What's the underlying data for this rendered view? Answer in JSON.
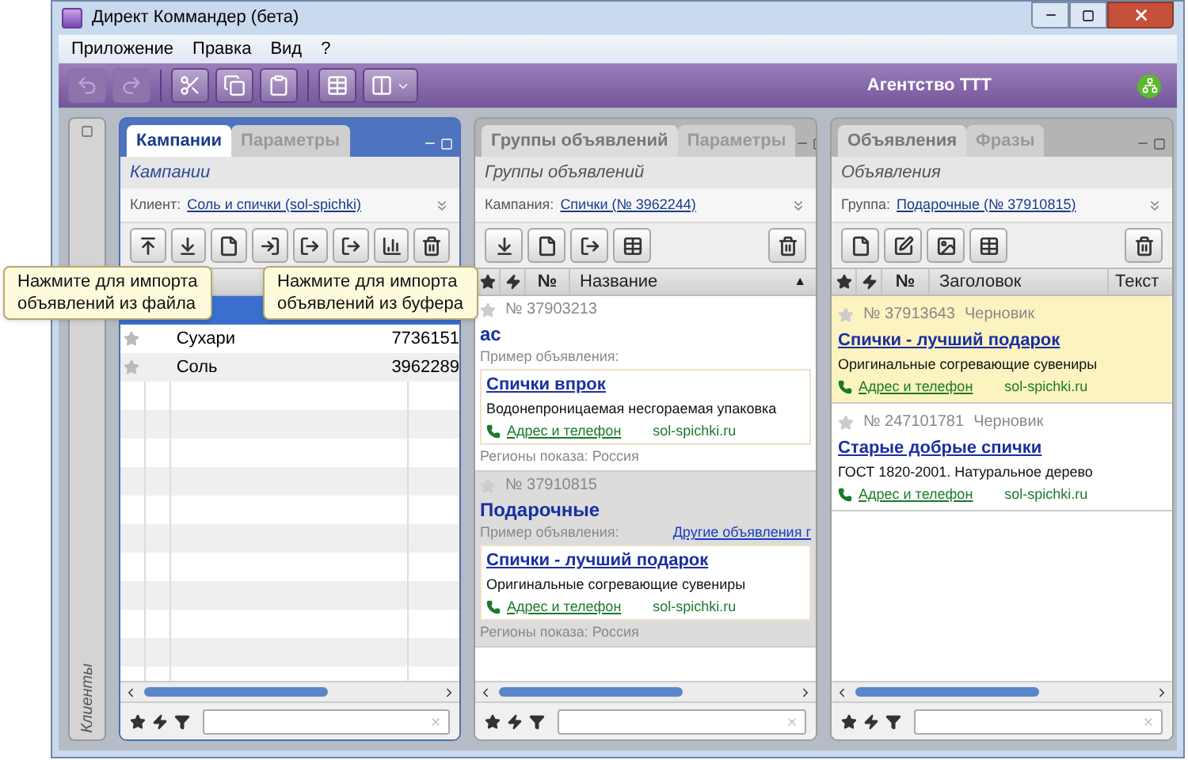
{
  "window": {
    "title": "Директ Коммандер (бета)"
  },
  "menu": [
    "Приложение",
    "Правка",
    "Вид",
    "?"
  ],
  "toolbar": [
    {
      "kind": "undo",
      "disabled": true
    },
    {
      "kind": "redo",
      "disabled": true
    },
    {
      "kind": "cut",
      "disabled": false
    },
    {
      "kind": "copy",
      "disabled": false
    },
    {
      "kind": "paste",
      "disabled": false
    },
    {
      "kind": "table",
      "disabled": false
    },
    {
      "kind": "split",
      "disabled": false
    }
  ],
  "agency": "Агентство ТТТ",
  "side_panel": {
    "label": "Клиенты"
  },
  "campaigns_panel": {
    "active": true,
    "tabs": [
      {
        "label": "Кампании",
        "selected": true
      },
      {
        "label": "Параметры",
        "selected": false
      }
    ],
    "subtitle": "Кампании",
    "filter": {
      "label": "Клиент:",
      "value": "Соль и спички (sol-spichki)"
    },
    "tools": [
      {
        "kind": "upload"
      },
      {
        "kind": "download"
      },
      {
        "kind": "new"
      },
      {
        "kind": "import_file"
      },
      {
        "kind": "import_buffer"
      },
      {
        "kind": "export"
      },
      {
        "kind": "stats"
      }
    ],
    "rows": [
      {
        "selected": true
      },
      {
        "selected": false,
        "name": "Сухари",
        "number": "7736151"
      },
      {
        "selected": false,
        "name": "Соль",
        "number": "3962289"
      }
    ]
  },
  "groups_panel": {
    "active": false,
    "tabs": [
      {
        "label": "Группы объявлений",
        "selected": true
      },
      {
        "label": "Параметры",
        "selected": false
      }
    ],
    "subtitle": "Группы объявлений",
    "filter": {
      "label": "Кампания:",
      "value": "Спички (№ 3962244)"
    },
    "tools": [
      {
        "kind": "download"
      },
      {
        "kind": "new"
      },
      {
        "kind": "export"
      },
      {
        "kind": "table"
      }
    ],
    "columns": [
      "№",
      "Название"
    ],
    "sort_mark": "▲",
    "groups": [
      {
        "selected": false,
        "number": "№ 37903213",
        "name": "ас",
        "sample_label": "Пример объявления:",
        "ad": {
          "title": "Спички впрок",
          "text": "Водонепроницаемая несгораемая упаковка",
          "link": "Адрес и телефон",
          "domain": "sol-spichki.ru"
        },
        "regions": "Регионы показа: Россия"
      },
      {
        "selected": true,
        "number": "№ 37910815",
        "name": "Подарочные",
        "sample_label": "Пример объявления:",
        "other_link": "Другие объявления г",
        "ad": {
          "title": "Спички - лучший подарок",
          "text": "Оригинальные согревающие сувениры",
          "link": "Адрес и телефон",
          "domain": "sol-spichki.ru"
        },
        "regions": "Регионы показа: Россия"
      }
    ]
  },
  "ads_panel": {
    "active": false,
    "tabs": [
      {
        "label": "Объявления",
        "selected": true
      },
      {
        "label": "Фразы",
        "selected": false
      }
    ],
    "subtitle": "Объявления",
    "filter": {
      "label": "Группа:",
      "value": "Подарочные (№ 37910815)"
    },
    "tools": [
      {
        "kind": "new"
      },
      {
        "kind": "edit"
      },
      {
        "kind": "image"
      },
      {
        "kind": "table"
      }
    ],
    "columns": [
      "№",
      "Заголовок",
      "Текст"
    ],
    "ads": [
      {
        "selected": true,
        "number": "№ 37913643",
        "status": "Черновик",
        "title": "Спички - лучший подарок",
        "text": "Оригинальные согревающие сувениры",
        "link": "Адрес и телефон",
        "domain": "sol-spichki.ru"
      },
      {
        "selected": false,
        "number": "№ 247101781",
        "status": "Черновик",
        "title": "Старые добрые спички",
        "text": "ГОСТ 1820-2001. Натуральное дерево",
        "link": "Адрес и телефон",
        "domain": "sol-spichki.ru"
      }
    ]
  },
  "tooltips": [
    "Нажмите для импорта\nобъявлений из файла",
    "Нажмите для импорта\nобъявлений из буфера"
  ]
}
